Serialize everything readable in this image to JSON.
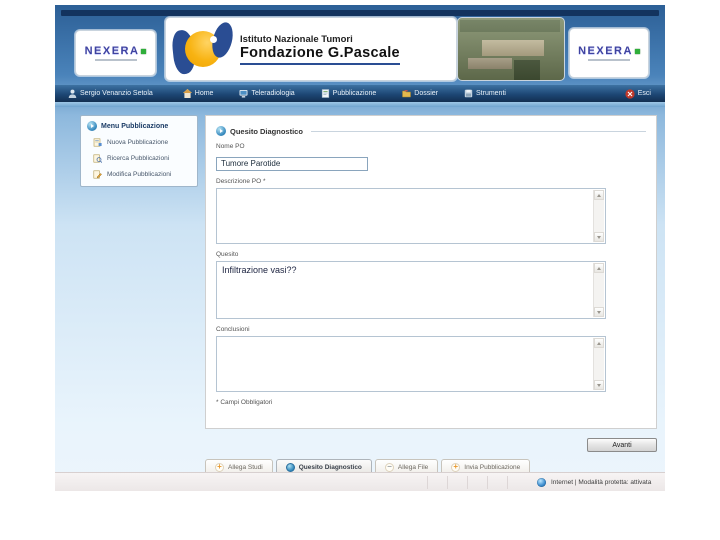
{
  "colors": {
    "navy": "#13335e",
    "nav_blue": "#1d4775",
    "accent_orange": "#f8b312",
    "brand_green": "#2fae3a",
    "page_blue": "#cde3f4"
  },
  "header": {
    "brand": "NEXERA",
    "org_line1": "Istituto Nazionale Tumori",
    "org_line2": "Fondazione G.Pascale",
    "photo_alt": "hospital-aerial-photo"
  },
  "nav": {
    "items": [
      {
        "label": "Sergio Venanzio Setola",
        "icon": "user-icon"
      },
      {
        "label": "Home",
        "icon": "home-icon"
      },
      {
        "label": "Teleradiologia",
        "icon": "monitor-icon"
      },
      {
        "label": "Pubblicazione",
        "icon": "publish-icon"
      },
      {
        "label": "Dossier",
        "icon": "dossier-icon"
      },
      {
        "label": "Strumenti",
        "icon": "tools-icon"
      }
    ],
    "exit": {
      "label": "Esci",
      "icon": "exit-icon"
    }
  },
  "sidebar": {
    "title": "Menu Pubblicazione",
    "items": [
      {
        "label": "Nuova Pubblicazione",
        "icon": "new-document-icon"
      },
      {
        "label": "Ricerca Pubblicazioni",
        "icon": "search-document-icon"
      },
      {
        "label": "Modifica Pubblicazioni",
        "icon": "edit-document-icon"
      }
    ]
  },
  "form": {
    "legend": "Quesito Diagnostico",
    "fields": {
      "nome_po": {
        "label": "Nome PO",
        "value": "Tumore Parotide"
      },
      "descrizione": {
        "label": "Descrizione PO *",
        "value": ""
      },
      "quesito": {
        "label": "Quesito",
        "value": "Infiltrazione vasi??"
      },
      "conclusioni": {
        "label": "Conclusioni",
        "value": ""
      }
    },
    "required_note": "* Campi Obbligatori",
    "submit_label": "Avanti"
  },
  "tabs": [
    {
      "label": "Allega Studi",
      "icon": "plus-circle-icon",
      "active": false
    },
    {
      "label": "Quesito Diagnostico",
      "icon": "blue-dot-icon",
      "active": true
    },
    {
      "label": "Allega File",
      "icon": "minus-circle-icon",
      "active": false
    },
    {
      "label": "Invia Pubblicazione",
      "icon": "plus-circle-icon",
      "active": false
    }
  ],
  "statusbar": {
    "text": "Internet | Modalità protetta: attivata",
    "icon": "globe-icon"
  }
}
